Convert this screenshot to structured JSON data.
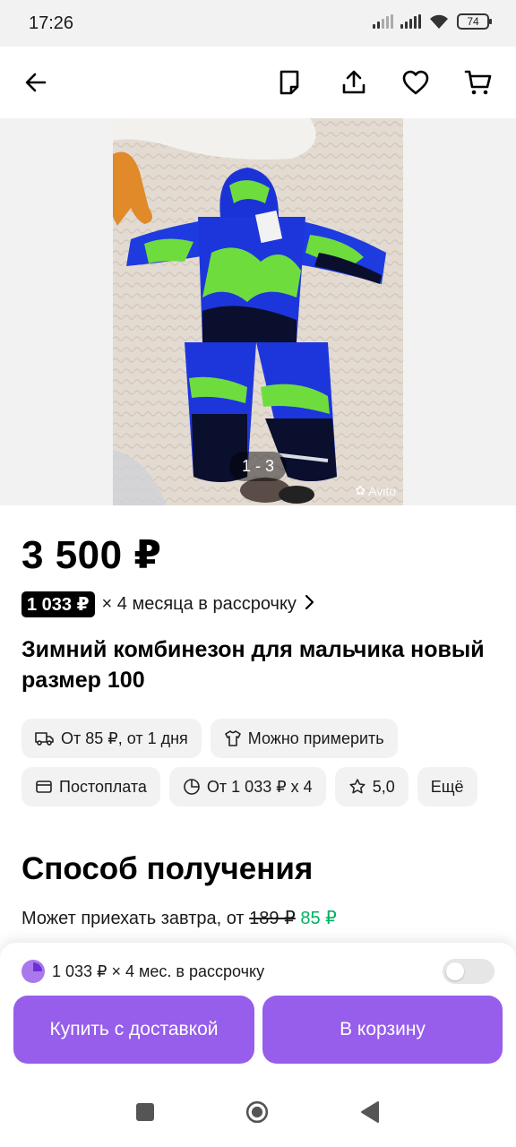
{
  "status_bar": {
    "time": "17:26",
    "battery": "74",
    "icons": [
      "signal-icon",
      "signal-icon",
      "wifi-icon",
      "battery-icon"
    ]
  },
  "app_bar": {
    "icons": [
      "back-arrow-icon",
      "note-icon",
      "share-icon",
      "heart-icon",
      "cart-icon"
    ]
  },
  "gallery": {
    "counter": "1 - 3",
    "watermark": "Avito"
  },
  "listing": {
    "price": "3 500 ₽",
    "installment_amount": "1 033 ₽",
    "installment_text": "× 4 месяца в рассрочку",
    "title": "Зимний комбинезон для мальчика новый размер 100"
  },
  "chips": {
    "row1": [
      {
        "label": "От 85 ₽, от 1 дня",
        "icon": "truck-icon"
      },
      {
        "label": "Можно примерить",
        "icon": "shirt-icon"
      }
    ],
    "row2": [
      {
        "label": "Постоплата",
        "icon": "wallet-icon"
      },
      {
        "label": "От 1 033 ₽ х 4",
        "icon": "pie-icon"
      },
      {
        "label": "5,0",
        "icon": "star-icon"
      },
      {
        "label": "Ещё",
        "icon": ""
      }
    ]
  },
  "delivery": {
    "section_title": "Способ получения",
    "prefix": "Может приехать завтра, от ",
    "old_price": "189 ₽",
    "new_price": "85 ₽"
  },
  "bottom_sheet": {
    "split_text": "1 033 ₽ × 4 мес. в рассрочку",
    "toggle_on": false,
    "buy_label": "Купить с доставкой",
    "cart_label": "В корзину",
    "accent": "#965eeb"
  },
  "nav_bar": {
    "icons": [
      "recents-square-icon",
      "home-circle-icon",
      "back-triangle-icon"
    ]
  }
}
